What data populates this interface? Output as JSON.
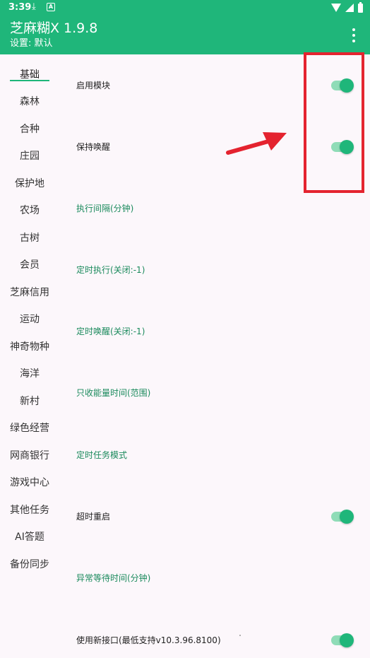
{
  "status_bar": {
    "time": "3:39",
    "icons": [
      "download-icon",
      "a-icon",
      "wifi-icon",
      "signal-icon",
      "battery-icon"
    ]
  },
  "app_bar": {
    "title": "芝麻糊X 1.9.8",
    "subtitle": "设置: 默认",
    "menu_icon": "more-vert-icon"
  },
  "sidebar": {
    "items": [
      {
        "label": "基础",
        "active": true
      },
      {
        "label": "森林"
      },
      {
        "label": "合种"
      },
      {
        "label": "庄园"
      },
      {
        "label": "保护地"
      },
      {
        "label": "农场"
      },
      {
        "label": "古树"
      },
      {
        "label": "会员"
      },
      {
        "label": "芝麻信用"
      },
      {
        "label": "运动"
      },
      {
        "label": "神奇物种"
      },
      {
        "label": "海洋"
      },
      {
        "label": "新村"
      },
      {
        "label": "绿色经营"
      },
      {
        "label": "网商银行"
      },
      {
        "label": "游戏中心"
      },
      {
        "label": "其他任务"
      },
      {
        "label": "AI答题"
      },
      {
        "label": "备份同步"
      }
    ]
  },
  "settings": [
    {
      "label": "启用模块",
      "type": "toggle",
      "checked": true
    },
    {
      "label": "保持唤醒",
      "type": "toggle",
      "checked": true
    },
    {
      "label": "执行间隔(分钟)",
      "type": "link"
    },
    {
      "label": "定时执行(关闭:-1)",
      "type": "link"
    },
    {
      "label": "定时唤醒(关闭:-1)",
      "type": "link"
    },
    {
      "label": "只收能量时间(范围)",
      "type": "link"
    },
    {
      "label": "定时任务模式",
      "type": "link"
    },
    {
      "label": "超时重启",
      "type": "toggle",
      "checked": true
    },
    {
      "label": "异常等待时间(分钟)",
      "type": "link"
    },
    {
      "label": "使用新接口(最低支持v10.3.96.8100)",
      "type": "toggle",
      "checked": true
    }
  ],
  "colors": {
    "accent": "#1fb67a",
    "annotation": "#e4232f",
    "link_text": "#1a8a5c",
    "background": "#fcf7fb"
  }
}
